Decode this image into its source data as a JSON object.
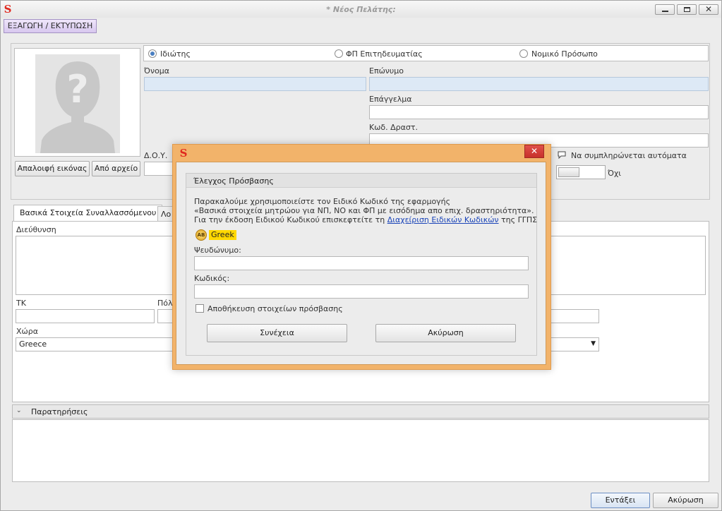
{
  "window": {
    "title": "* Νέος Πελάτης:",
    "logo": "S"
  },
  "toolbar": {
    "export_label": "ΕΞΑΓΩΓΗ / ΕΚΤΥΠΩΣΗ"
  },
  "photo": {
    "clear_label": "Απαλοιφή εικόνας",
    "from_file_label": "Από αρχείο"
  },
  "entity_type": {
    "options": [
      "Ιδιώτης",
      "ΦΠ Επιτηδευματίας",
      "Νομικό Πρόσωπο"
    ],
    "selected": "Ιδιώτης"
  },
  "form": {
    "first_name_label": "Όνομα",
    "last_name_label": "Επώνυμο",
    "profession_label": "Επάγγελμα",
    "activity_code_label": "Κωδ. Δραστ.",
    "tax_office_label": "Δ.Ο.Υ.",
    "autofill_label": "Να συμπληρώνεται αυτόματα",
    "autofill_value": "Όχι"
  },
  "tabs": [
    {
      "label": "Βασικά Στοιχεία Συναλλασσόμενου",
      "active": true
    },
    {
      "label": "Λο",
      "active": false
    }
  ],
  "address": {
    "address_label": "Διεύθυνση",
    "zip_label": "ΤΚ",
    "city_label": "Πόλ",
    "country_label": "Χώρα",
    "country_value": "Greece"
  },
  "notes": {
    "label": "Παρατηρήσεις"
  },
  "footer": {
    "ok_label": "Εντάξει",
    "cancel_label": "Ακύρωση"
  },
  "dialog": {
    "logo": "S",
    "close_glyph": "✕",
    "group_title": "Έλεγχος Πρόσβασης",
    "message_line1": "Παρακαλούμε χρησιμοποιείστε τον Ειδικό Κωδικό της εφαρμογής",
    "message_line2": "«Βασικά στοιχεία μητρώου για ΝΠ, ΝΟ και ΦΠ με εισόδημα απο επιχ. δραστηριότητα».",
    "message_line3_pre": "Για την έκδοση Ειδικού Κωδικού επισκεφτείτε τη ",
    "message_link": "Διαχείριση Ειδικών Κωδικών",
    "message_line3_post": " της ΓΓΠΣ",
    "language_label": "Greek",
    "language_icon": "AB",
    "username_label": "Ψευδώνυμο:",
    "password_label": "Κωδικός:",
    "remember_label": "Αποθήκευση στοιχείων πρόσβασης",
    "continue_label": "Συνέχεια",
    "cancel_label": "Ακύρωση"
  }
}
